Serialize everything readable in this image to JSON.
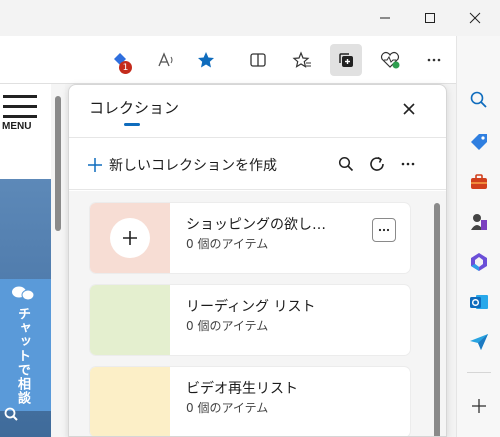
{
  "webpage": {
    "menu_label": "MENU",
    "chat_label": "チャットで相談"
  },
  "panel": {
    "title": "コレクション",
    "new_collection_label": "新しいコレクションを作成",
    "collections": [
      {
        "title": "ショッピングの欲し…",
        "subtitle": "0 個のアイテム",
        "color": "#f7ddd4"
      },
      {
        "title": "リーディング リスト",
        "subtitle": "0 個のアイテム",
        "color": "#e4efcf"
      },
      {
        "title": "ビデオ再生リスト",
        "subtitle": "0 個のアイテム",
        "color": "#fcefc7"
      }
    ]
  },
  "toolbar": {
    "badge_count": "1",
    "accent": "#0f6cbd"
  },
  "icons": {
    "toolbar": [
      "extension-icon",
      "read-aloud-icon",
      "favorite-star-icon",
      "split-screen-icon",
      "favorites-icon",
      "collections-icon",
      "browser-essentials-icon",
      "more-icon",
      "copilot-icon"
    ],
    "sidebar": [
      "search-icon",
      "shopping-tag-icon",
      "tools-icon",
      "games-icon",
      "microsoft365-icon",
      "outlook-icon",
      "send-icon",
      "add-icon"
    ]
  }
}
